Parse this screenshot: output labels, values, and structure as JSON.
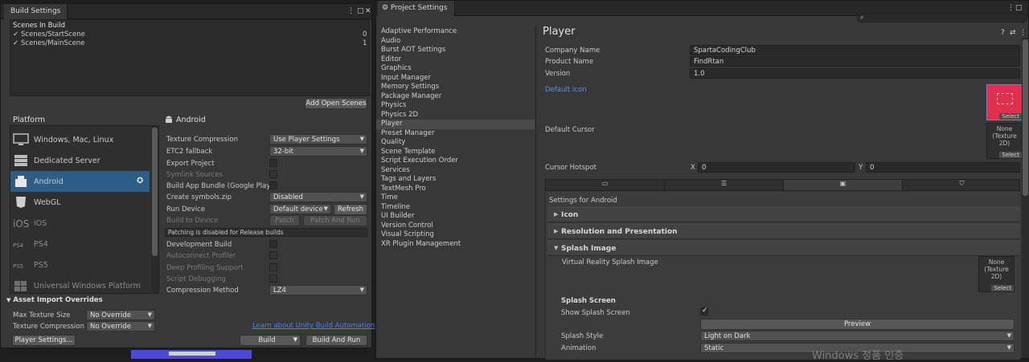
{
  "build_settings": {
    "tab_title": "Build Settings",
    "scenes_header": "Scenes In Build",
    "scenes": [
      {
        "name": "Scenes/StartScene",
        "index": "0",
        "checked": true
      },
      {
        "name": "Scenes/MainScene",
        "index": "1",
        "checked": true
      }
    ],
    "add_open_scenes": "Add Open Scenes",
    "platform_header": "Platform",
    "platforms": [
      {
        "label": "Windows, Mac, Linux",
        "icon": "monitor-icon"
      },
      {
        "label": "Dedicated Server",
        "icon": "server-icon"
      },
      {
        "label": "Android",
        "icon": "android-icon",
        "selected": true
      },
      {
        "label": "WebGL",
        "icon": "html5-icon"
      },
      {
        "label": "iOS",
        "icon": "ios-icon"
      },
      {
        "label": "PS4",
        "icon": "ps4-icon"
      },
      {
        "label": "PS5",
        "icon": "ps5-icon"
      },
      {
        "label": "Universal Windows Platform",
        "icon": "windows-icon"
      }
    ],
    "android_title": "Android",
    "settings": [
      {
        "label": "Texture Compression",
        "kind": "dropdown",
        "value": "Use Player Settings"
      },
      {
        "label": "ETC2 fallback",
        "kind": "dropdown",
        "value": "32-bit"
      },
      {
        "label": "Export Project",
        "kind": "checkbox"
      },
      {
        "label": "Symlink Sources",
        "kind": "checkbox",
        "disabled": true
      },
      {
        "label": "Build App Bundle (Google Play)",
        "kind": "checkbox"
      },
      {
        "label": "Create symbols.zip",
        "kind": "dropdown",
        "value": "Disabled"
      },
      {
        "label": "Run Device",
        "kind": "device",
        "value": "Default device",
        "button": "Refresh"
      },
      {
        "label": "Build to Device",
        "kind": "buttons",
        "disabled": true,
        "buttons": [
          "Patch",
          "Patch And Run"
        ]
      },
      {
        "label": "Patching is disabled for Release builds",
        "kind": "info"
      },
      {
        "label": "Development Build",
        "kind": "checkbox"
      },
      {
        "label": "Autoconnect Profiler",
        "kind": "checkbox",
        "disabled": true
      },
      {
        "label": "Deep Profiling Support",
        "kind": "checkbox",
        "disabled": true
      },
      {
        "label": "Script Debugging",
        "kind": "checkbox",
        "disabled": true
      },
      {
        "label": "Compression Method",
        "kind": "dropdown",
        "value": "LZ4"
      }
    ],
    "asset_import_header": "Asset Import Overrides",
    "asset_import": [
      {
        "label": "Max Texture Size",
        "value": "No Override"
      },
      {
        "label": "Texture Compression",
        "value": "No Override"
      }
    ],
    "learn_link": "Learn about Unity Build Automation",
    "player_settings_button": "Player Settings...",
    "build_button": "Build",
    "build_and_run_button": "Build And Run"
  },
  "project_settings": {
    "tab_title": "Project Settings",
    "categories": [
      "Adaptive Performance",
      "Audio",
      "Burst AOT Settings",
      "Editor",
      "Graphics",
      "Input Manager",
      "Memory Settings",
      "Package Manager",
      "Physics",
      "Physics 2D",
      "Player",
      "Preset Manager",
      "Quality",
      "Scene Template",
      "Script Execution Order",
      "Services",
      "Tags and Layers",
      "TextMesh Pro",
      "Time",
      "Timeline",
      "UI Builder",
      "Version Control",
      "Visual Scripting",
      "XR Plugin Management"
    ],
    "selected_category": "Player",
    "player": {
      "title": "Player",
      "company_name_label": "Company Name",
      "company_name": "SpartaCodingClub",
      "product_name_label": "Product Name",
      "product_name": "FindRtan",
      "version_label": "Version",
      "version": "1.0",
      "default_icon_label": "Default Icon",
      "default_cursor_label": "Default Cursor",
      "cursor_texture": "None\n(Texture 2D)",
      "select_label": "Select",
      "cursor_hotspot_label": "Cursor Hotspot",
      "hotspot_x_label": "X",
      "hotspot_x": "0",
      "hotspot_y_label": "Y",
      "hotspot_y": "0",
      "platform_tabs": [
        "monitor-icon",
        "server-icon",
        "android-icon",
        "html5-icon"
      ],
      "settings_for": "Settings for Android",
      "sections": [
        "Icon",
        "Resolution and Presentation",
        "Splash Image"
      ],
      "vr_splash_label": "Virtual Reality Splash Image",
      "vr_splash_texture": "None\n(Texture 2D)",
      "splash_screen_header": "Splash Screen",
      "show_splash_label": "Show Splash Screen",
      "preview_button": "Preview",
      "splash_style_label": "Splash Style",
      "splash_style": "Light on Dark",
      "animation_label": "Animation",
      "animation": "Static"
    }
  },
  "watermark": "Windows 정품 인증",
  "colors": {
    "accent_selected": "#2c5d87",
    "link": "#4c7eff",
    "icon_red": "#e0304e"
  }
}
